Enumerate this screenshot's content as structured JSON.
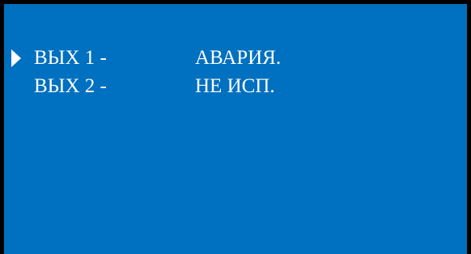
{
  "menu": {
    "items": [
      {
        "label": "ВЫХ 1 -",
        "value": "АВАРИЯ.",
        "selected": true
      },
      {
        "label": "ВЫХ 2 -",
        "value": "НЕ ИСП.",
        "selected": false
      }
    ]
  },
  "colors": {
    "background": "#0070C0",
    "border": "#000000",
    "text": "#FFFFFF"
  },
  "icons": {
    "cursor": "selection-arrow-icon"
  }
}
